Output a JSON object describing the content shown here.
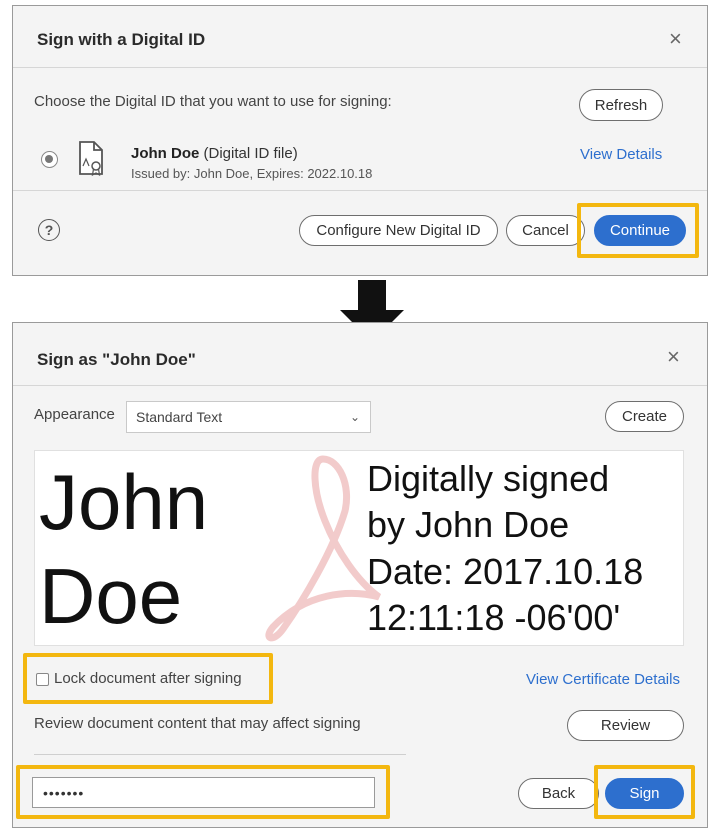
{
  "dialog1": {
    "title": "Sign with a Digital ID",
    "close_glyph": "×",
    "prompt": "Choose the Digital ID that you want to use for signing:",
    "refresh_label": "Refresh",
    "id_name": "John Doe",
    "id_type": " (Digital ID file)",
    "id_issued": "Issued by: John Doe, Expires: 2022.10.18",
    "view_details_label": "View Details",
    "help_glyph": "?",
    "configure_label": "Configure New Digital ID",
    "cancel_label": "Cancel",
    "continue_label": "Continue"
  },
  "dialog2": {
    "title": "Sign as \"John Doe\"",
    "close_glyph": "×",
    "appearance_label": "Appearance",
    "appearance_value": "Standard Text",
    "create_label": "Create",
    "preview": {
      "name_line1": "John",
      "name_line2": "Doe",
      "info_line1": "Digitally signed",
      "info_line2": "by John Doe",
      "info_line3": "Date: 2017.10.18",
      "info_line4": "12:11:18 -06'00'"
    },
    "lock_label": "Lock document after signing",
    "lock_checked": false,
    "view_certificate_label": "View Certificate Details",
    "review_text": "Review document content that may affect signing",
    "review_label": "Review",
    "password_value": "•••••••",
    "back_label": "Back",
    "sign_label": "Sign"
  },
  "colors": {
    "accent": "#2d6fce",
    "highlight": "#f3b70f",
    "dialog_bg": "#f4f4f4"
  }
}
